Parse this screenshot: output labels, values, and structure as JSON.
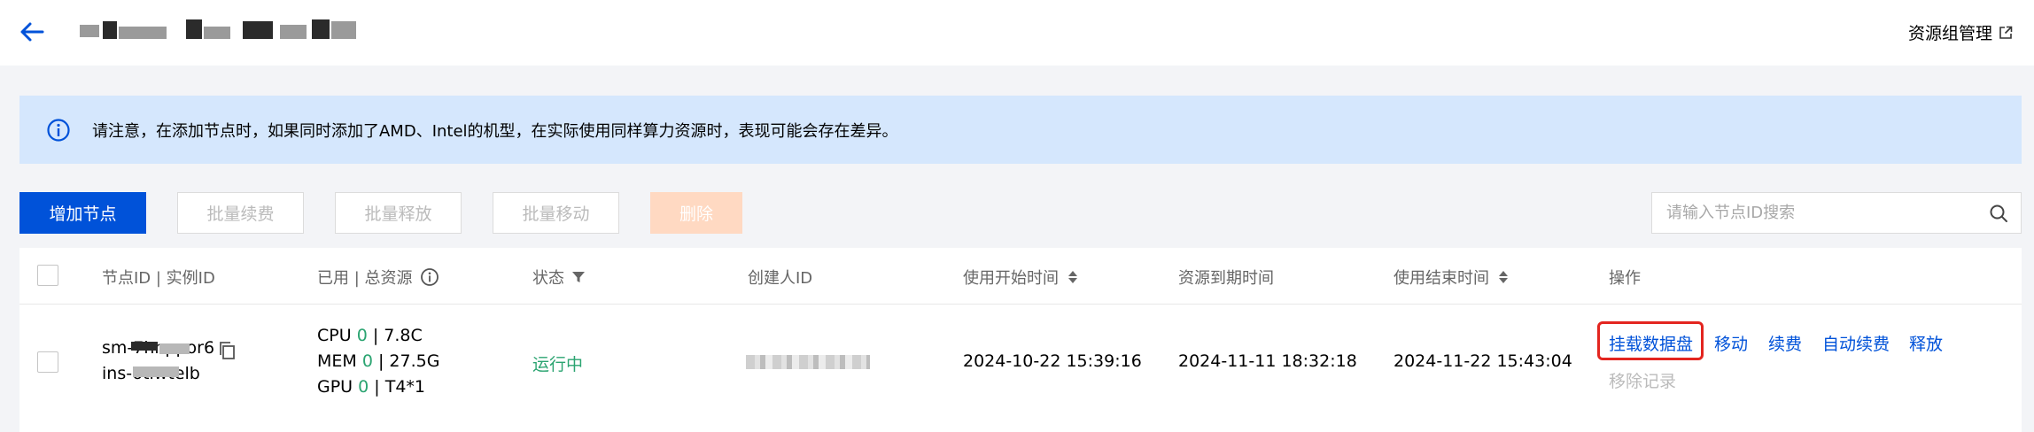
{
  "header": {
    "title_fragments": [
      "leg",
      "U",
      "0",
      "q",
      ",",
      "H",
      "4",
      "c",
      "o",
      "t",
      "l"
    ],
    "resource_group_link": "资源组管理"
  },
  "notice": {
    "text": "请注意，在添加节点时，如果同时添加了AMD、Intel的机型，在实际使用同样算力资源时，表现可能会存在差异。"
  },
  "toolbar": {
    "add_node": "增加节点",
    "batch_renew": "批量续费",
    "batch_release": "批量释放",
    "batch_move": "批量移动",
    "delete": "删除",
    "search_placeholder": "请输入节点ID搜索"
  },
  "table": {
    "columns": {
      "node_id": "节点ID | 实例ID",
      "resources": "已用 | 总资源",
      "status": "状态",
      "creator": "创建人ID",
      "start_time": "使用开始时间",
      "expire_time": "资源到期时间",
      "end_time": "使用结束时间",
      "actions": "操作"
    },
    "rows": [
      {
        "node_id": "sm-7hnppor6",
        "instance_id": "ins-otlwtelb",
        "cpu_label": "CPU",
        "cpu_used": "0",
        "cpu_total": " | 7.8C",
        "mem_label": "MEM",
        "mem_used": "0",
        "mem_total": " | 27.5G",
        "gpu_label": "GPU",
        "gpu_used": "0",
        "gpu_total": " | T4*1",
        "status": "运行中",
        "start_time": "2024-10-22 15:39:16",
        "expire_time": "2024-11-11 18:32:18",
        "end_time": "2024-11-22 15:43:04",
        "actions": {
          "mount_disk": "挂载数据盘",
          "move": "移动",
          "renew": "续费",
          "auto_renew": "自动续费",
          "release": "释放",
          "remove_record": "移除记录"
        }
      }
    ]
  },
  "colors": {
    "primary": "#0052d9",
    "success": "#2ba471",
    "notice_bg": "#d5e7fd",
    "danger_outline": "#e3251f"
  }
}
